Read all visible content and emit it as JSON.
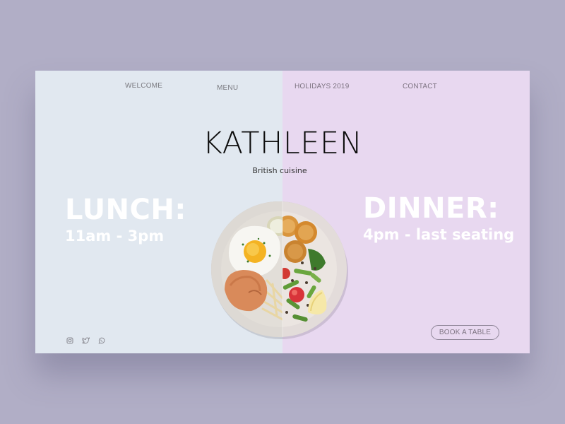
{
  "nav": {
    "items": [
      {
        "label": "WELCOME"
      },
      {
        "label": "MENU"
      },
      {
        "label": "HOLIDAYS 2019"
      },
      {
        "label": "CONTACT"
      }
    ]
  },
  "hero": {
    "brand": "KATHLEEN",
    "tagline": "British cuisine",
    "image_alt": "Half plate of British breakfast with fried egg, fish cake and chips; half plate of roasted potatoes, green beans, tomato, kale and lemon"
  },
  "hours": {
    "lunch": {
      "title": "LUNCH:",
      "time": "11am - 3pm"
    },
    "dinner": {
      "title": "DINNER:",
      "time": "4pm - last seating"
    }
  },
  "social": {
    "icons": [
      "instagram-icon",
      "twitter-icon",
      "whatsapp-icon"
    ]
  },
  "cta": {
    "book_label": "BOOK A TABLE"
  },
  "colors": {
    "page_background": "#b1aec6",
    "left_panel": "#e1e8f0",
    "right_panel": "#e8d8f0",
    "heading_text": "#ffffff",
    "brand_text": "#0d0d0d"
  }
}
